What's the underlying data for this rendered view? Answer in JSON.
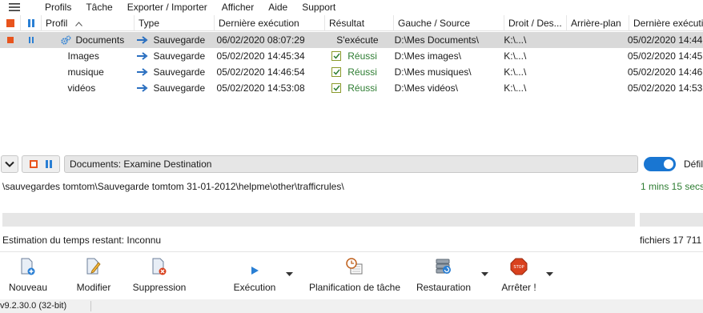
{
  "menu": {
    "items": [
      "Profils",
      "Tâche",
      "Exporter / Importer",
      "Afficher",
      "Aide",
      "Support"
    ]
  },
  "table": {
    "headers": {
      "profil": "Profil",
      "type": "Type",
      "last_run": "Dernière exécution",
      "result": "Résultat",
      "source": "Gauche / Source",
      "right": "Droit / Des...",
      "background": "Arrière-plan",
      "last_run2": "Dernière exécutio"
    },
    "rows": [
      {
        "profil": "Documents",
        "type": "Sauvegarde",
        "last_run": "06/02/2020 08:07:29",
        "result": "S'exécute",
        "source": "D:\\Mes Documents\\",
        "right": "K:\\...\\",
        "background": "",
        "last_run2": "05/02/2020 14:44"
      },
      {
        "profil": "Images",
        "type": "Sauvegarde",
        "last_run": "05/02/2020 14:45:34",
        "result": "Réussi",
        "source": "D:\\Mes images\\",
        "right": "K:\\...\\",
        "background": "",
        "last_run2": "05/02/2020 14:45"
      },
      {
        "profil": "musique",
        "type": "Sauvegarde",
        "last_run": "05/02/2020 14:46:54",
        "result": "Réussi",
        "source": "D:\\Mes musiques\\",
        "right": "K:\\...\\",
        "background": "",
        "last_run2": "05/02/2020 14:46"
      },
      {
        "profil": "vidéos",
        "type": "Sauvegarde",
        "last_run": "05/02/2020 14:53:08",
        "result": "Réussi",
        "source": "D:\\Mes vidéos\\",
        "right": "K:\\...\\",
        "background": "",
        "last_run2": "05/02/2020 14:53"
      }
    ]
  },
  "progress": {
    "status_text": "Documents: Examine Destination",
    "toggle_label": "Défil",
    "current_path": "\\sauvegardes tomtom\\Sauvegarde tomtom 31-01-2012\\helpme\\other\\trafficrules\\",
    "elapsed": "1 mins 15 secs",
    "estimate": "Estimation du temps restant: Inconnu",
    "files": "fichiers 17 711"
  },
  "toolbar": {
    "new": "Nouveau",
    "edit": "Modifier",
    "delete": "Suppression",
    "run": "Exécution",
    "schedule": "Planification de tâche",
    "restore": "Restauration",
    "stop": "Arrêter !"
  },
  "statusbar": {
    "version": "v9.2.30.0 (32-bit)"
  },
  "colors": {
    "accent": "#1976d2",
    "stop_red": "#e8541d",
    "success_green": "#2e7d32",
    "selected_row": "#d9d9d9"
  }
}
